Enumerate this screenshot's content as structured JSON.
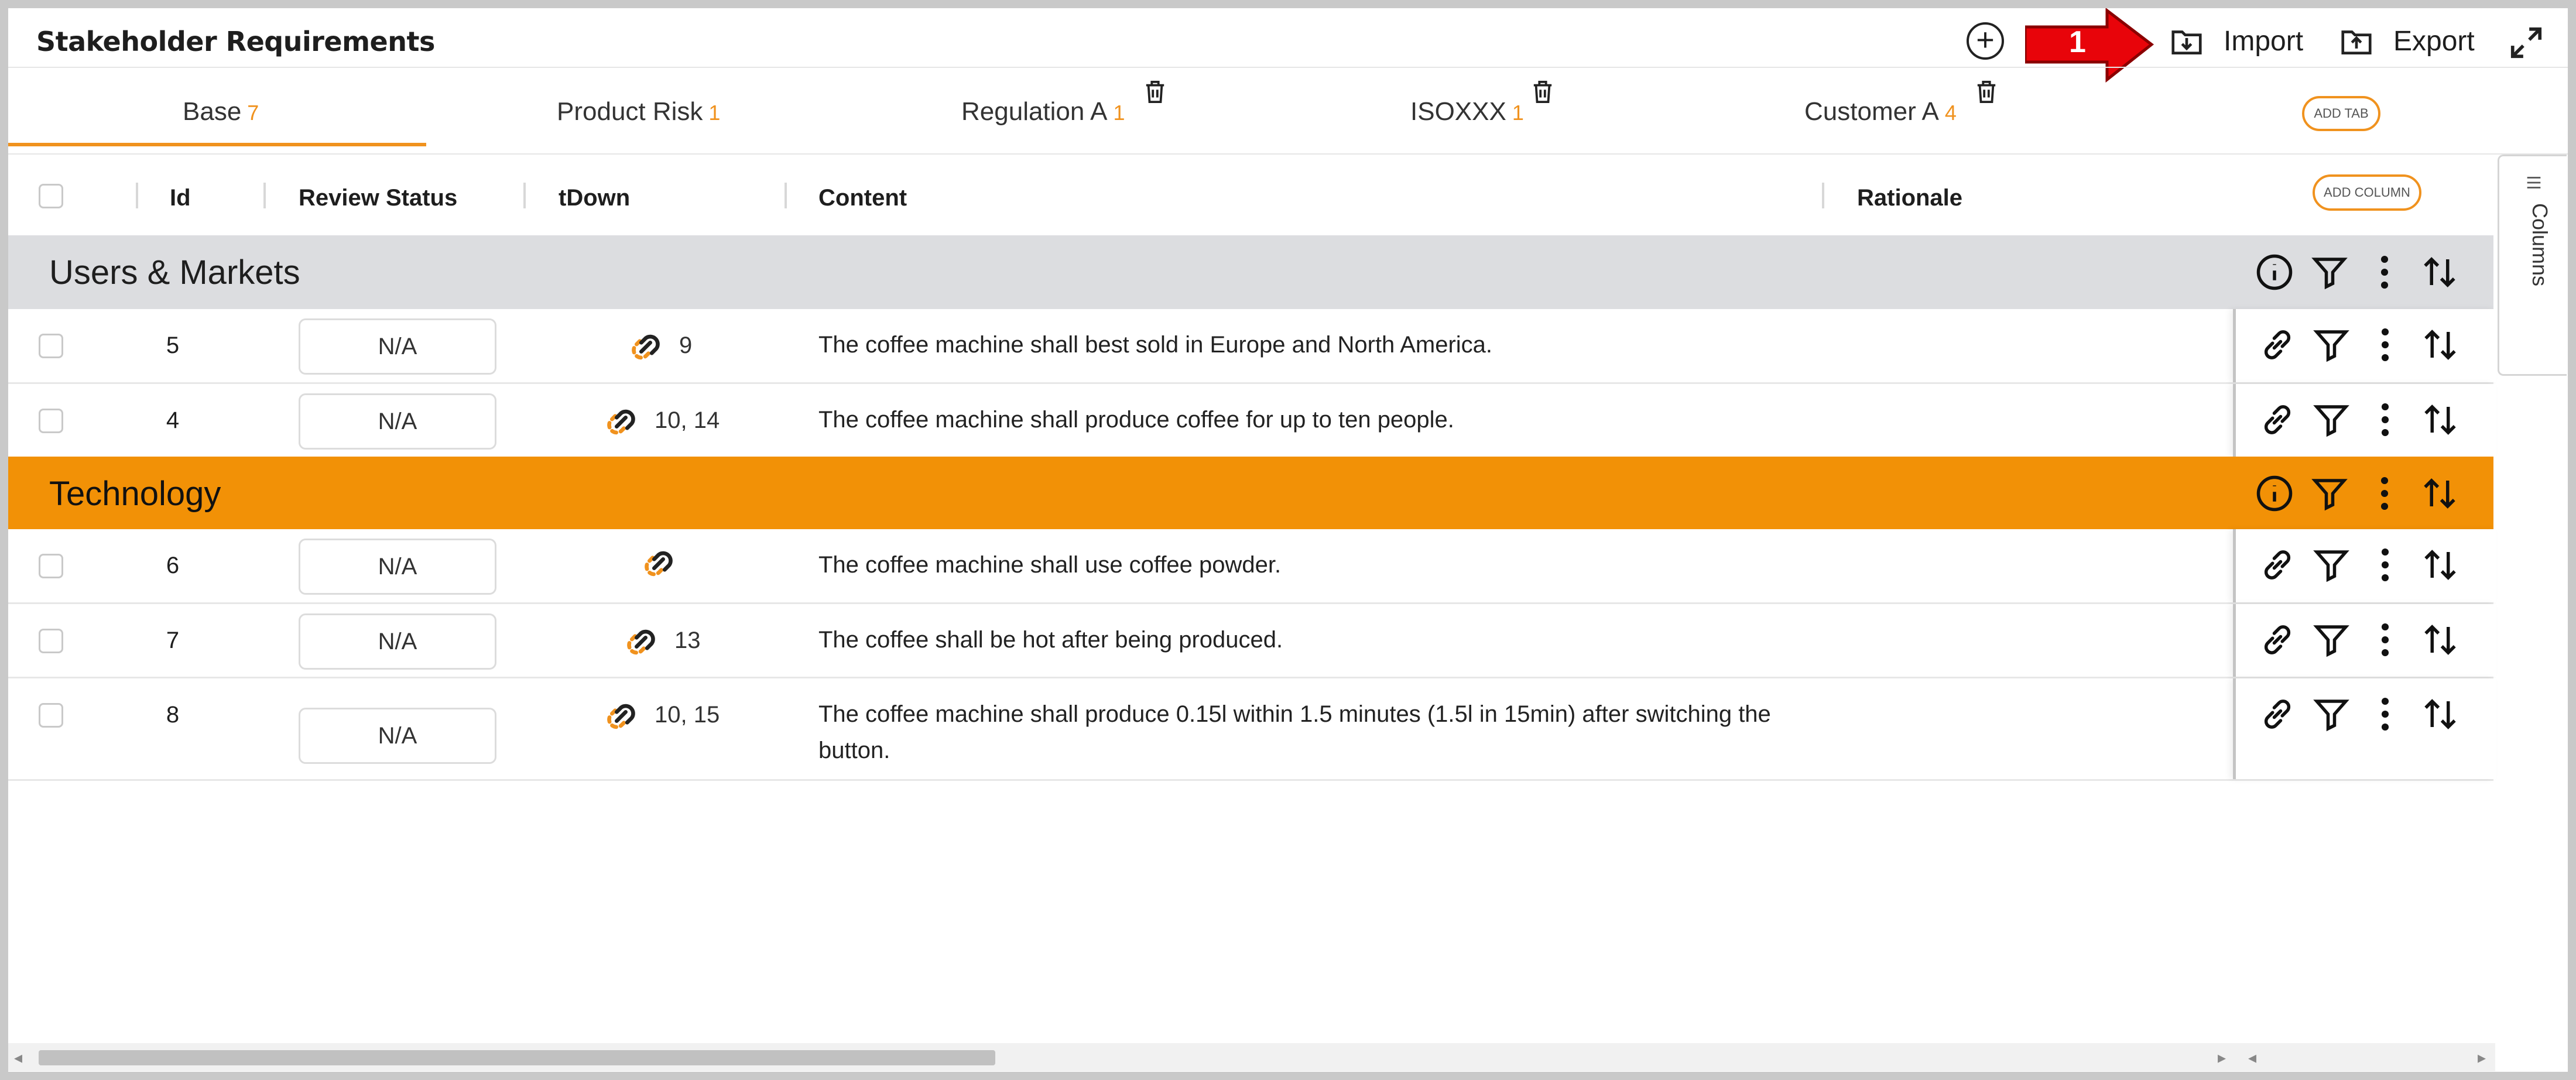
{
  "header": {
    "title": "Stakeholder Requirements",
    "import_label": "Import",
    "export_label": "Export",
    "callout_number": "1"
  },
  "tabs": [
    {
      "label": "Base",
      "count": "7"
    },
    {
      "label": "Product Risk",
      "count": "1"
    },
    {
      "label": "Regulation A",
      "count": "1"
    },
    {
      "label": "ISOXXX",
      "count": "1"
    },
    {
      "label": "Customer A",
      "count": "4"
    }
  ],
  "add_tab_label": "ADD TAB",
  "add_column_label": "ADD COLUMN",
  "columns": {
    "id": "Id",
    "review_status": "Review Status",
    "tdown": "tDown",
    "content": "Content",
    "rationale": "Rationale"
  },
  "side_panel_label": "Columns",
  "groups": [
    {
      "label": "Users & Markets",
      "rows": [
        {
          "id": "5",
          "status": "N/A",
          "tdown": "9",
          "content": "The coffee machine shall best sold in Europe and North America."
        },
        {
          "id": "4",
          "status": "N/A",
          "tdown": "10, 14",
          "content": "The coffee machine shall produce coffee for up to ten people."
        }
      ]
    },
    {
      "label": "Technology",
      "rows": [
        {
          "id": "6",
          "status": "N/A",
          "tdown": "",
          "content": "The coffee machine shall use coffee powder."
        },
        {
          "id": "7",
          "status": "N/A",
          "tdown": "13",
          "content": "The coffee shall be hot after being produced."
        },
        {
          "id": "8",
          "status": "N/A",
          "tdown": "10, 15",
          "content": "The coffee machine shall produce 0.15l within 1.5 minutes (1.5l in 15min) after switching the button."
        }
      ]
    }
  ],
  "colors": {
    "accent": "#f0921e",
    "group_gray": "#dcdde0",
    "group_orange": "#f29106",
    "callout_red": "#e8040a"
  },
  "icons": [
    "add-circle-icon",
    "import-icon",
    "export-icon",
    "expand-icon",
    "trash-icon",
    "link-icon",
    "info-icon",
    "filter-icon",
    "kebab-icon",
    "sort-icon",
    "columns-icon"
  ]
}
